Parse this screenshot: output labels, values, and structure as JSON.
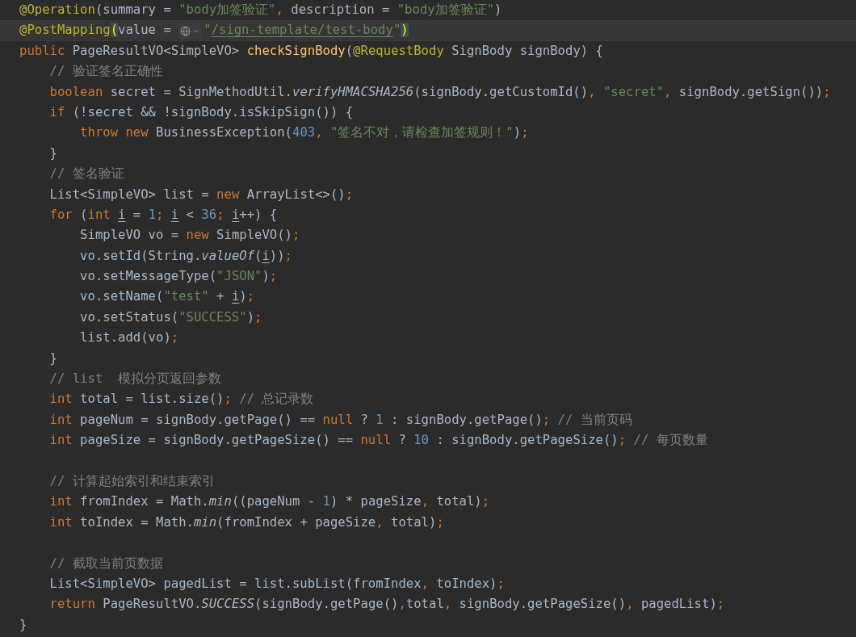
{
  "editor": {
    "lines": [
      {
        "kind": "code",
        "current": false,
        "tokens": [
          {
            "kind": "a",
            "text": "@Operation"
          },
          {
            "kind": "p",
            "text": "(summary = "
          },
          {
            "kind": "s",
            "text": "\"body加签验证\""
          },
          {
            "kind": "k",
            "text": ", "
          },
          {
            "kind": "p",
            "text": "description = "
          },
          {
            "kind": "s",
            "text": "\"body加签验证\""
          },
          {
            "kind": "p",
            "text": ")"
          }
        ]
      },
      {
        "kind": "code",
        "current": true,
        "tokens": [
          {
            "kind": "a",
            "text": "@PostMapping"
          },
          {
            "kind": "bm",
            "text": "("
          },
          {
            "kind": "p",
            "text": "value = "
          },
          {
            "kind": "inlay"
          },
          {
            "kind": "s",
            "text": "\""
          },
          {
            "kind": "url",
            "text": "/sign-template/test-body"
          },
          {
            "kind": "s",
            "text": "\""
          },
          {
            "kind": "bm",
            "text": ")"
          }
        ]
      },
      {
        "kind": "code",
        "current": false,
        "tokens": [
          {
            "kind": "k",
            "text": "public "
          },
          {
            "kind": "p",
            "text": "PageResultVO<SimpleVO> "
          },
          {
            "kind": "f",
            "text": "checkSignBody"
          },
          {
            "kind": "p",
            "text": "("
          },
          {
            "kind": "a",
            "text": "@RequestBody"
          },
          {
            "kind": "p",
            "text": " SignBody signBody) {"
          }
        ]
      },
      {
        "kind": "code",
        "current": false,
        "tokens": [
          {
            "kind": "c",
            "text": "    // 验证签名正确性"
          }
        ]
      },
      {
        "kind": "code",
        "current": false,
        "tokens": [
          {
            "kind": "k",
            "text": "    boolean "
          },
          {
            "kind": "p",
            "text": "secret = SignMethodUtil."
          },
          {
            "kind": "i",
            "text": "verifyHMACSHA256"
          },
          {
            "kind": "p",
            "text": "(signBody.getCustomId()"
          },
          {
            "kind": "k",
            "text": ", "
          },
          {
            "kind": "s",
            "text": "\"secret\""
          },
          {
            "kind": "k",
            "text": ", "
          },
          {
            "kind": "p",
            "text": "signBody.getSign())"
          },
          {
            "kind": "k",
            "text": ";"
          }
        ]
      },
      {
        "kind": "code",
        "current": false,
        "tokens": [
          {
            "kind": "k",
            "text": "    if "
          },
          {
            "kind": "p",
            "text": "(!secret && !signBody.isSkipSign()) {"
          }
        ]
      },
      {
        "kind": "code",
        "current": false,
        "tokens": [
          {
            "kind": "k",
            "text": "        throw new "
          },
          {
            "kind": "p",
            "text": "BusinessException("
          },
          {
            "kind": "n",
            "text": "403"
          },
          {
            "kind": "k",
            "text": ", "
          },
          {
            "kind": "s",
            "text": "\"签名不对，请检查加签规则！\""
          },
          {
            "kind": "p",
            "text": ")"
          },
          {
            "kind": "k",
            "text": ";"
          }
        ]
      },
      {
        "kind": "code",
        "current": false,
        "tokens": [
          {
            "kind": "p",
            "text": "    }"
          }
        ]
      },
      {
        "kind": "code",
        "current": false,
        "tokens": [
          {
            "kind": "c",
            "text": "    // 签名验证"
          }
        ]
      },
      {
        "kind": "code",
        "current": false,
        "tokens": [
          {
            "kind": "p",
            "text": "    List<SimpleVO> list = "
          },
          {
            "kind": "k",
            "text": "new "
          },
          {
            "kind": "p",
            "text": "ArrayList<>()"
          },
          {
            "kind": "k",
            "text": ";"
          }
        ]
      },
      {
        "kind": "code",
        "current": false,
        "tokens": [
          {
            "kind": "k",
            "text": "    for "
          },
          {
            "kind": "p",
            "text": "("
          },
          {
            "kind": "k",
            "text": "int "
          },
          {
            "kind": "u",
            "text": "i"
          },
          {
            "kind": "p",
            "text": " = "
          },
          {
            "kind": "n",
            "text": "1"
          },
          {
            "kind": "k",
            "text": "; "
          },
          {
            "kind": "u",
            "text": "i"
          },
          {
            "kind": "p",
            "text": " < "
          },
          {
            "kind": "n",
            "text": "36"
          },
          {
            "kind": "k",
            "text": "; "
          },
          {
            "kind": "u",
            "text": "i"
          },
          {
            "kind": "p",
            "text": "++) {"
          }
        ]
      },
      {
        "kind": "code",
        "current": false,
        "tokens": [
          {
            "kind": "p",
            "text": "        SimpleVO vo = "
          },
          {
            "kind": "k",
            "text": "new "
          },
          {
            "kind": "p",
            "text": "SimpleVO()"
          },
          {
            "kind": "k",
            "text": ";"
          }
        ]
      },
      {
        "kind": "code",
        "current": false,
        "tokens": [
          {
            "kind": "p",
            "text": "        vo.setId(String."
          },
          {
            "kind": "i",
            "text": "valueOf"
          },
          {
            "kind": "p",
            "text": "("
          },
          {
            "kind": "u",
            "text": "i"
          },
          {
            "kind": "p",
            "text": "))"
          },
          {
            "kind": "k",
            "text": ";"
          }
        ]
      },
      {
        "kind": "code",
        "current": false,
        "tokens": [
          {
            "kind": "p",
            "text": "        vo.setMessageType("
          },
          {
            "kind": "s",
            "text": "\"JSON\""
          },
          {
            "kind": "p",
            "text": ")"
          },
          {
            "kind": "k",
            "text": ";"
          }
        ]
      },
      {
        "kind": "code",
        "current": false,
        "tokens": [
          {
            "kind": "p",
            "text": "        vo.setName("
          },
          {
            "kind": "s",
            "text": "\"test\""
          },
          {
            "kind": "p",
            "text": " + "
          },
          {
            "kind": "u",
            "text": "i"
          },
          {
            "kind": "p",
            "text": ")"
          },
          {
            "kind": "k",
            "text": ";"
          }
        ]
      },
      {
        "kind": "code",
        "current": false,
        "tokens": [
          {
            "kind": "p",
            "text": "        vo.setStatus("
          },
          {
            "kind": "s",
            "text": "\"SUCCESS\""
          },
          {
            "kind": "p",
            "text": ")"
          },
          {
            "kind": "k",
            "text": ";"
          }
        ]
      },
      {
        "kind": "code",
        "current": false,
        "tokens": [
          {
            "kind": "p",
            "text": "        list.add(vo)"
          },
          {
            "kind": "k",
            "text": ";"
          }
        ]
      },
      {
        "kind": "code",
        "current": false,
        "tokens": [
          {
            "kind": "p",
            "text": "    }"
          }
        ]
      },
      {
        "kind": "code",
        "current": false,
        "tokens": [
          {
            "kind": "c",
            "text": "    // list  模拟分页返回参数"
          }
        ]
      },
      {
        "kind": "code",
        "current": false,
        "tokens": [
          {
            "kind": "k",
            "text": "    int "
          },
          {
            "kind": "p",
            "text": "total = list.size()"
          },
          {
            "kind": "k",
            "text": "; "
          },
          {
            "kind": "c",
            "text": "// 总记录数"
          }
        ]
      },
      {
        "kind": "code",
        "current": false,
        "tokens": [
          {
            "kind": "k",
            "text": "    int "
          },
          {
            "kind": "p",
            "text": "pageNum = signBody.getPage() == "
          },
          {
            "kind": "k",
            "text": "null "
          },
          {
            "kind": "p",
            "text": "? "
          },
          {
            "kind": "n",
            "text": "1"
          },
          {
            "kind": "p",
            "text": " : signBody.getPage()"
          },
          {
            "kind": "k",
            "text": "; "
          },
          {
            "kind": "c",
            "text": "// 当前页码"
          }
        ]
      },
      {
        "kind": "code",
        "current": false,
        "tokens": [
          {
            "kind": "k",
            "text": "    int "
          },
          {
            "kind": "p",
            "text": "pageSize = signBody.getPageSize() == "
          },
          {
            "kind": "k",
            "text": "null "
          },
          {
            "kind": "p",
            "text": "? "
          },
          {
            "kind": "n",
            "text": "10"
          },
          {
            "kind": "p",
            "text": " : signBody.getPageSize()"
          },
          {
            "kind": "k",
            "text": "; "
          },
          {
            "kind": "c",
            "text": "// 每页数量"
          }
        ]
      },
      {
        "kind": "blank",
        "current": false
      },
      {
        "kind": "code",
        "current": false,
        "tokens": [
          {
            "kind": "c",
            "text": "    // 计算起始索引和结束索引"
          }
        ]
      },
      {
        "kind": "code",
        "current": false,
        "tokens": [
          {
            "kind": "k",
            "text": "    int "
          },
          {
            "kind": "p",
            "text": "fromIndex = Math."
          },
          {
            "kind": "i",
            "text": "min"
          },
          {
            "kind": "p",
            "text": "((pageNum - "
          },
          {
            "kind": "n",
            "text": "1"
          },
          {
            "kind": "p",
            "text": ") * pageSize"
          },
          {
            "kind": "k",
            "text": ", "
          },
          {
            "kind": "p",
            "text": "total)"
          },
          {
            "kind": "k",
            "text": ";"
          }
        ]
      },
      {
        "kind": "code",
        "current": false,
        "tokens": [
          {
            "kind": "k",
            "text": "    int "
          },
          {
            "kind": "p",
            "text": "toIndex = Math."
          },
          {
            "kind": "i",
            "text": "min"
          },
          {
            "kind": "p",
            "text": "(fromIndex + pageSize"
          },
          {
            "kind": "k",
            "text": ", "
          },
          {
            "kind": "p",
            "text": "total)"
          },
          {
            "kind": "k",
            "text": ";"
          }
        ]
      },
      {
        "kind": "blank",
        "current": false
      },
      {
        "kind": "code",
        "current": false,
        "tokens": [
          {
            "kind": "c",
            "text": "    // 截取当前页数据"
          }
        ]
      },
      {
        "kind": "code",
        "current": false,
        "tokens": [
          {
            "kind": "p",
            "text": "    List<SimpleVO> pagedList = list.subList(fromIndex"
          },
          {
            "kind": "k",
            "text": ", "
          },
          {
            "kind": "p",
            "text": "toIndex)"
          },
          {
            "kind": "k",
            "text": ";"
          }
        ]
      },
      {
        "kind": "code",
        "current": false,
        "tokens": [
          {
            "kind": "k",
            "text": "    return "
          },
          {
            "kind": "p",
            "text": "PageResultVO."
          },
          {
            "kind": "i",
            "text": "SUCCESS"
          },
          {
            "kind": "p",
            "text": "(signBody.getPage()"
          },
          {
            "kind": "k",
            "text": ","
          },
          {
            "kind": "p",
            "text": "total"
          },
          {
            "kind": "k",
            "text": ", "
          },
          {
            "kind": "p",
            "text": "signBody.getPageSize()"
          },
          {
            "kind": "k",
            "text": ", "
          },
          {
            "kind": "p",
            "text": "pagedList)"
          },
          {
            "kind": "k",
            "text": ";"
          }
        ]
      },
      {
        "kind": "code",
        "current": false,
        "tokens": [
          {
            "kind": "p",
            "text": "}"
          }
        ]
      }
    ]
  }
}
